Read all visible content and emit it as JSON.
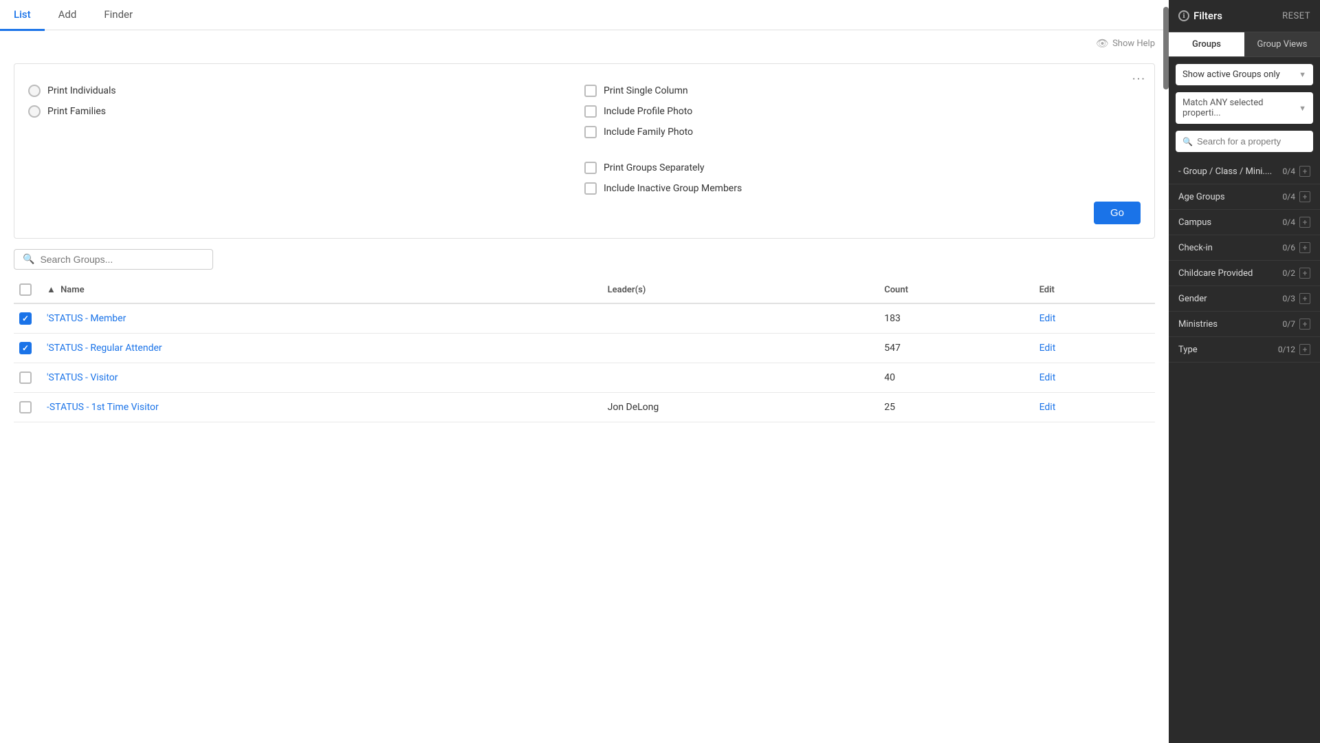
{
  "nav": {
    "tabs": [
      {
        "label": "List",
        "active": true
      },
      {
        "label": "Add",
        "active": false
      },
      {
        "label": "Finder",
        "active": false
      }
    ]
  },
  "show_help": "Show Help",
  "three_dots": "···",
  "print_options": {
    "left": [
      {
        "label": "Print Individuals",
        "type": "radio"
      },
      {
        "label": "Print Families",
        "type": "radio"
      }
    ],
    "right_top": [
      {
        "label": "Print Single Column",
        "type": "checkbox"
      },
      {
        "label": "Include Profile Photo",
        "type": "checkbox"
      },
      {
        "label": "Include Family Photo",
        "type": "checkbox"
      }
    ],
    "right_bottom": [
      {
        "label": "Print Groups Separately",
        "type": "checkbox"
      },
      {
        "label": "Include Inactive Group Members",
        "type": "checkbox"
      }
    ]
  },
  "go_button": "Go",
  "search": {
    "placeholder": "Search Groups..."
  },
  "table": {
    "headers": [
      {
        "label": "Name",
        "sortable": true,
        "sorted": true
      },
      {
        "label": "Leader(s)",
        "sortable": false
      },
      {
        "label": "Count",
        "sortable": false
      },
      {
        "label": "Edit",
        "sortable": false
      }
    ],
    "rows": [
      {
        "checked": true,
        "name": "'STATUS - Member",
        "leaders": "",
        "count": "183",
        "edit": "Edit"
      },
      {
        "checked": true,
        "name": "'STATUS - Regular Attender",
        "leaders": "",
        "count": "547",
        "edit": "Edit"
      },
      {
        "checked": false,
        "name": "'STATUS - Visitor",
        "leaders": "",
        "count": "40",
        "edit": "Edit"
      },
      {
        "checked": false,
        "name": "-STATUS - 1st Time Visitor",
        "leaders": "Jon DeLong",
        "count": "25",
        "edit": "Edit"
      }
    ]
  },
  "sidebar": {
    "title": "Filters",
    "reset": "RESET",
    "tabs": [
      {
        "label": "Groups",
        "active": true
      },
      {
        "label": "Group Views",
        "active": false
      }
    ],
    "active_groups_dropdown": "Show active Groups only",
    "match_dropdown": "Match ANY selected properti...",
    "search_placeholder": "Search for a property",
    "filter_items": [
      {
        "label": "- Group / Class / Mini....",
        "count": "0/4"
      },
      {
        "label": "Age Groups",
        "count": "0/4"
      },
      {
        "label": "Campus",
        "count": "0/4"
      },
      {
        "label": "Check-in",
        "count": "0/6"
      },
      {
        "label": "Childcare Provided",
        "count": "0/2"
      },
      {
        "label": "Gender",
        "count": "0/3"
      },
      {
        "label": "Ministries",
        "count": "0/7"
      },
      {
        "label": "Type",
        "count": "0/12"
      }
    ]
  }
}
